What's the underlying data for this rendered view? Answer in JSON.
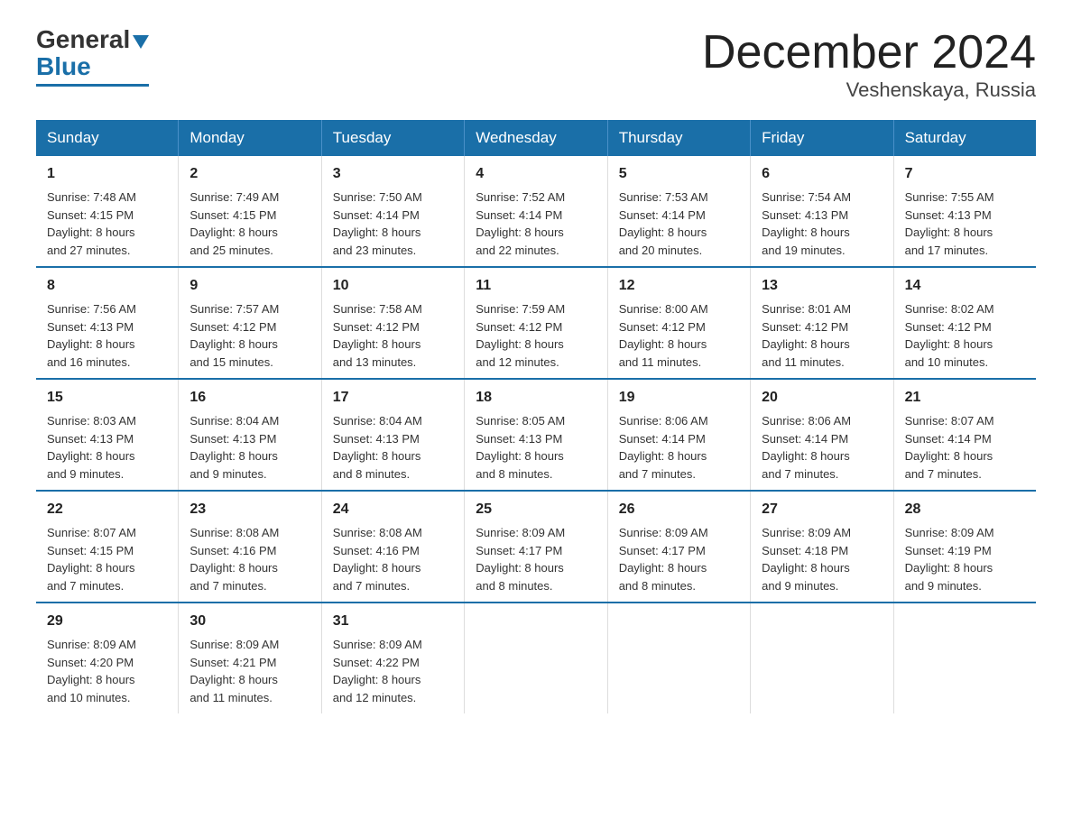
{
  "logo": {
    "general": "General",
    "blue": "Blue"
  },
  "title": "December 2024",
  "subtitle": "Veshenskaya, Russia",
  "weekdays": [
    "Sunday",
    "Monday",
    "Tuesday",
    "Wednesday",
    "Thursday",
    "Friday",
    "Saturday"
  ],
  "weeks": [
    [
      {
        "day": "1",
        "sunrise": "7:48 AM",
        "sunset": "4:15 PM",
        "daylight": "8 hours and 27 minutes."
      },
      {
        "day": "2",
        "sunrise": "7:49 AM",
        "sunset": "4:15 PM",
        "daylight": "8 hours and 25 minutes."
      },
      {
        "day": "3",
        "sunrise": "7:50 AM",
        "sunset": "4:14 PM",
        "daylight": "8 hours and 23 minutes."
      },
      {
        "day": "4",
        "sunrise": "7:52 AM",
        "sunset": "4:14 PM",
        "daylight": "8 hours and 22 minutes."
      },
      {
        "day": "5",
        "sunrise": "7:53 AM",
        "sunset": "4:14 PM",
        "daylight": "8 hours and 20 minutes."
      },
      {
        "day": "6",
        "sunrise": "7:54 AM",
        "sunset": "4:13 PM",
        "daylight": "8 hours and 19 minutes."
      },
      {
        "day": "7",
        "sunrise": "7:55 AM",
        "sunset": "4:13 PM",
        "daylight": "8 hours and 17 minutes."
      }
    ],
    [
      {
        "day": "8",
        "sunrise": "7:56 AM",
        "sunset": "4:13 PM",
        "daylight": "8 hours and 16 minutes."
      },
      {
        "day": "9",
        "sunrise": "7:57 AM",
        "sunset": "4:12 PM",
        "daylight": "8 hours and 15 minutes."
      },
      {
        "day": "10",
        "sunrise": "7:58 AM",
        "sunset": "4:12 PM",
        "daylight": "8 hours and 13 minutes."
      },
      {
        "day": "11",
        "sunrise": "7:59 AM",
        "sunset": "4:12 PM",
        "daylight": "8 hours and 12 minutes."
      },
      {
        "day": "12",
        "sunrise": "8:00 AM",
        "sunset": "4:12 PM",
        "daylight": "8 hours and 11 minutes."
      },
      {
        "day": "13",
        "sunrise": "8:01 AM",
        "sunset": "4:12 PM",
        "daylight": "8 hours and 11 minutes."
      },
      {
        "day": "14",
        "sunrise": "8:02 AM",
        "sunset": "4:12 PM",
        "daylight": "8 hours and 10 minutes."
      }
    ],
    [
      {
        "day": "15",
        "sunrise": "8:03 AM",
        "sunset": "4:13 PM",
        "daylight": "8 hours and 9 minutes."
      },
      {
        "day": "16",
        "sunrise": "8:04 AM",
        "sunset": "4:13 PM",
        "daylight": "8 hours and 9 minutes."
      },
      {
        "day": "17",
        "sunrise": "8:04 AM",
        "sunset": "4:13 PM",
        "daylight": "8 hours and 8 minutes."
      },
      {
        "day": "18",
        "sunrise": "8:05 AM",
        "sunset": "4:13 PM",
        "daylight": "8 hours and 8 minutes."
      },
      {
        "day": "19",
        "sunrise": "8:06 AM",
        "sunset": "4:14 PM",
        "daylight": "8 hours and 7 minutes."
      },
      {
        "day": "20",
        "sunrise": "8:06 AM",
        "sunset": "4:14 PM",
        "daylight": "8 hours and 7 minutes."
      },
      {
        "day": "21",
        "sunrise": "8:07 AM",
        "sunset": "4:14 PM",
        "daylight": "8 hours and 7 minutes."
      }
    ],
    [
      {
        "day": "22",
        "sunrise": "8:07 AM",
        "sunset": "4:15 PM",
        "daylight": "8 hours and 7 minutes."
      },
      {
        "day": "23",
        "sunrise": "8:08 AM",
        "sunset": "4:16 PM",
        "daylight": "8 hours and 7 minutes."
      },
      {
        "day": "24",
        "sunrise": "8:08 AM",
        "sunset": "4:16 PM",
        "daylight": "8 hours and 7 minutes."
      },
      {
        "day": "25",
        "sunrise": "8:09 AM",
        "sunset": "4:17 PM",
        "daylight": "8 hours and 8 minutes."
      },
      {
        "day": "26",
        "sunrise": "8:09 AM",
        "sunset": "4:17 PM",
        "daylight": "8 hours and 8 minutes."
      },
      {
        "day": "27",
        "sunrise": "8:09 AM",
        "sunset": "4:18 PM",
        "daylight": "8 hours and 9 minutes."
      },
      {
        "day": "28",
        "sunrise": "8:09 AM",
        "sunset": "4:19 PM",
        "daylight": "8 hours and 9 minutes."
      }
    ],
    [
      {
        "day": "29",
        "sunrise": "8:09 AM",
        "sunset": "4:20 PM",
        "daylight": "8 hours and 10 minutes."
      },
      {
        "day": "30",
        "sunrise": "8:09 AM",
        "sunset": "4:21 PM",
        "daylight": "8 hours and 11 minutes."
      },
      {
        "day": "31",
        "sunrise": "8:09 AM",
        "sunset": "4:22 PM",
        "daylight": "8 hours and 12 minutes."
      },
      null,
      null,
      null,
      null
    ]
  ],
  "labels": {
    "sunrise": "Sunrise:",
    "sunset": "Sunset:",
    "daylight": "Daylight:"
  }
}
